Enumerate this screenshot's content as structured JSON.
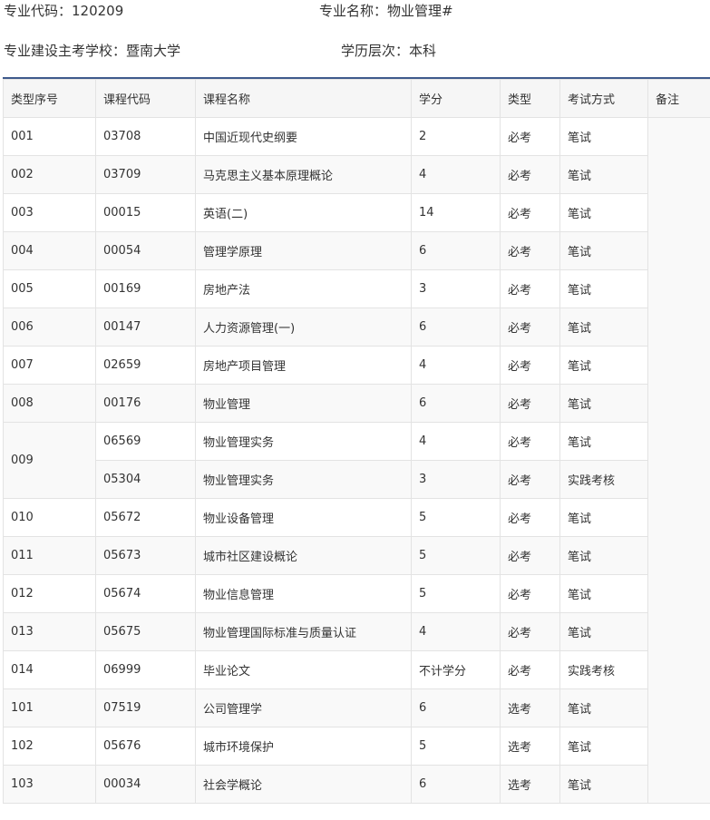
{
  "header": {
    "major_code": "专业代码：120209",
    "major_name": "专业名称：物业管理#",
    "school": "专业建设主考学校：暨南大学",
    "level": "学历层次：本科"
  },
  "table": {
    "columns": [
      "类型序号",
      "课程代码",
      "课程名称",
      "学分",
      "类型",
      "考试方式",
      "备注"
    ],
    "rows": [
      {
        "seq": "001",
        "code": "03708",
        "name": "中国近现代史纲要",
        "credit": "2",
        "type": "必考",
        "exam": "笔试"
      },
      {
        "seq": "002",
        "code": "03709",
        "name": "马克思主义基本原理概论",
        "credit": "4",
        "type": "必考",
        "exam": "笔试"
      },
      {
        "seq": "003",
        "code": "00015",
        "name": "英语(二)",
        "credit": "14",
        "type": "必考",
        "exam": "笔试"
      },
      {
        "seq": "004",
        "code": "00054",
        "name": "管理学原理",
        "credit": "6",
        "type": "必考",
        "exam": "笔试"
      },
      {
        "seq": "005",
        "code": "00169",
        "name": "房地产法",
        "credit": "3",
        "type": "必考",
        "exam": "笔试"
      },
      {
        "seq": "006",
        "code": "00147",
        "name": "人力资源管理(一)",
        "credit": "6",
        "type": "必考",
        "exam": "笔试"
      },
      {
        "seq": "007",
        "code": "02659",
        "name": "房地产项目管理",
        "credit": "4",
        "type": "必考",
        "exam": "笔试"
      },
      {
        "seq": "008",
        "code": "00176",
        "name": "物业管理",
        "credit": "6",
        "type": "必考",
        "exam": "笔试"
      },
      {
        "seq": "009",
        "code": "06569",
        "name": "物业管理实务",
        "credit": "4",
        "type": "必考",
        "exam": "笔试"
      },
      {
        "seq": "",
        "code": "05304",
        "name": "物业管理实务",
        "credit": "3",
        "type": "必考",
        "exam": "实践考核"
      },
      {
        "seq": "010",
        "code": "05672",
        "name": "物业设备管理",
        "credit": "5",
        "type": "必考",
        "exam": "笔试"
      },
      {
        "seq": "011",
        "code": "05673",
        "name": "城市社区建设概论",
        "credit": "5",
        "type": "必考",
        "exam": "笔试"
      },
      {
        "seq": "012",
        "code": "05674",
        "name": "物业信息管理",
        "credit": "5",
        "type": "必考",
        "exam": "笔试"
      },
      {
        "seq": "013",
        "code": "05675",
        "name": "物业管理国际标准与质量认证",
        "credit": "4",
        "type": "必考",
        "exam": "笔试"
      },
      {
        "seq": "014",
        "code": "06999",
        "name": "毕业论文",
        "credit": "不计学分",
        "type": "必考",
        "exam": "实践考核"
      },
      {
        "seq": "101",
        "code": "07519",
        "name": "公司管理学",
        "credit": "6",
        "type": "选考",
        "exam": "笔试"
      },
      {
        "seq": "102",
        "code": "05676",
        "name": "城市环境保护",
        "credit": "5",
        "type": "选考",
        "exam": "笔试"
      },
      {
        "seq": "103",
        "code": "00034",
        "name": "社会学概论",
        "credit": "6",
        "type": "选考",
        "exam": "笔试"
      }
    ]
  }
}
